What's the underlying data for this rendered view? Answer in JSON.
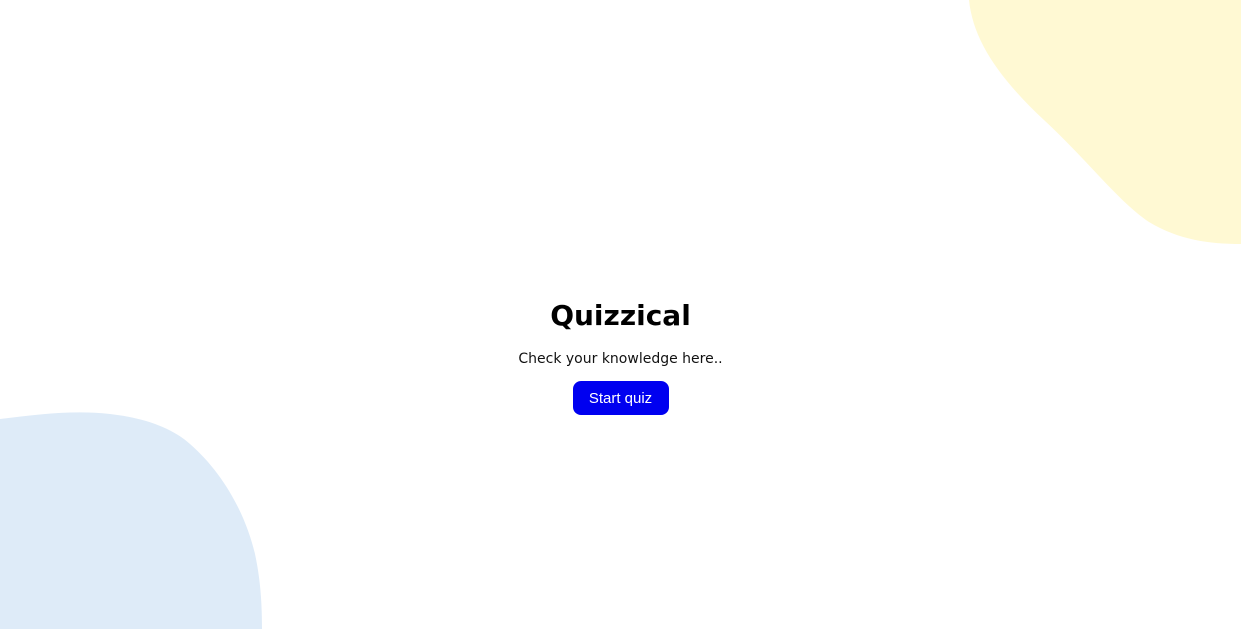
{
  "app": {
    "title": "Quizzical",
    "subtitle": "Check your knowledge here..",
    "start_button_label": "Start quiz"
  },
  "theme": {
    "accent": "#0000F0",
    "blob_top_right": "#FFF9D3",
    "blob_bottom_left": "#DEEBF8"
  }
}
